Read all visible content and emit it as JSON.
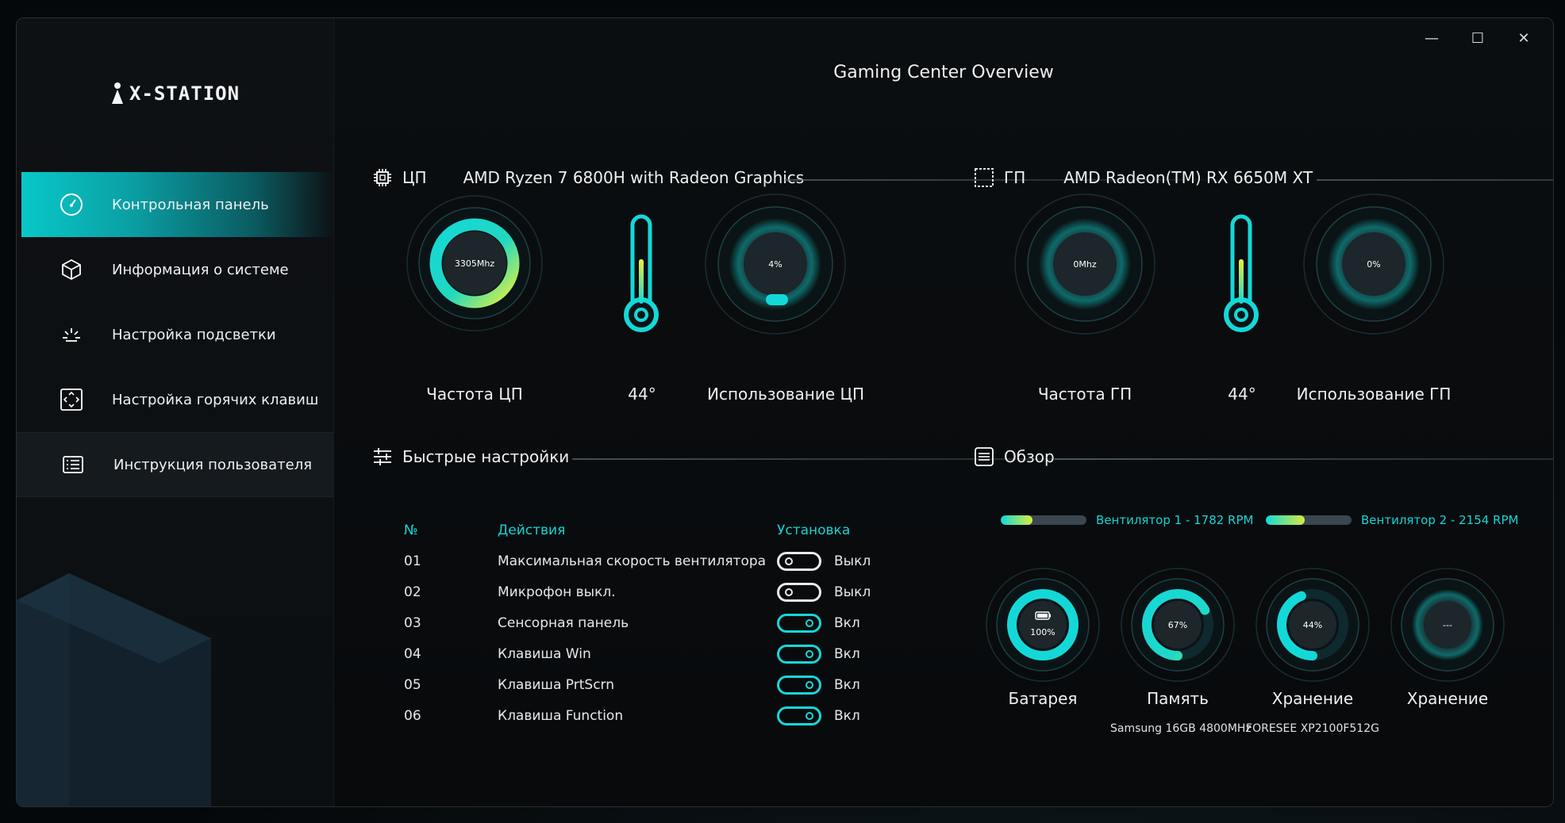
{
  "app": {
    "brand": "X-STATION",
    "page_title": "Gaming Center Overview"
  },
  "window_controls": [
    "—",
    "☐",
    "✕"
  ],
  "sidebar": {
    "items": [
      {
        "label": "Контрольная панель",
        "icon": "gauge-icon",
        "active": true
      },
      {
        "label": "Информация о системе",
        "icon": "cube-icon"
      },
      {
        "label": "Настройка подсветки",
        "icon": "light-icon"
      },
      {
        "label": "Настройка горячих клавиш",
        "icon": "keyboard-frame-icon"
      },
      {
        "label": "Инструкция пользователя",
        "icon": "manual-icon"
      }
    ]
  },
  "cpu": {
    "section": "ЦП",
    "model": "AMD Ryzen 7 6800H with Radeon Graphics",
    "freq_value": "3305Mhz",
    "freq_label": "Частота ЦП",
    "temp_value": "44°",
    "temp_fraction": 0.44,
    "usage_value": "4%",
    "usage_label": "Использование ЦП",
    "freq_ring_fraction": 1.0
  },
  "gpu": {
    "section": "ГП",
    "model": "AMD Radeon(TM) RX 6650M XT",
    "freq_value": "0Mhz",
    "freq_label": "Частота ГП",
    "temp_value": "44°",
    "temp_fraction": 0.44,
    "usage_value": "0%",
    "usage_label": "Использование ГП"
  },
  "quick_settings": {
    "title": "Быстрые настройки",
    "headers": {
      "num": "№",
      "action": "Действия",
      "setting": "Установка"
    },
    "rows": [
      {
        "num": "01",
        "action": "Максимальная скорость вентилятора",
        "state": "Выкл",
        "on": false
      },
      {
        "num": "02",
        "action": "Микрофон выкл.",
        "state": "Выкл",
        "on": false
      },
      {
        "num": "03",
        "action": "Сенсорная панель",
        "state": "Вкл",
        "on": true
      },
      {
        "num": "04",
        "action": "Клавиша Win",
        "state": "Вкл",
        "on": true
      },
      {
        "num": "05",
        "action": "Клавиша PrtScrn",
        "state": "Вкл",
        "on": true
      },
      {
        "num": "06",
        "action": "Клавиша Function",
        "state": "Вкл",
        "on": true
      }
    ]
  },
  "overview": {
    "title": "Обзор",
    "fans": [
      {
        "label": "Вентилятор 1 - 1782 RPM",
        "fraction": 0.37
      },
      {
        "label": "Вентилятор 2 - 2154 RPM",
        "fraction": 0.45
      }
    ],
    "meters": [
      {
        "value": "100%",
        "label": "Батарея",
        "sub": "",
        "fraction": 1.0,
        "battery_icon": true
      },
      {
        "value": "67%",
        "label": "Память",
        "sub": "Samsung 16GB 4800MHz",
        "fraction": 0.67
      },
      {
        "value": "44%",
        "label": "Хранение",
        "sub": "FORESEE XP2100F512G",
        "fraction": 0.44
      },
      {
        "value": "---",
        "label": "Хранение",
        "sub": "",
        "fraction": 0
      }
    ]
  },
  "colors": {
    "accent": "#14d8d8",
    "accent_yellow": "#d8ec3c",
    "track": "#3a4650"
  }
}
